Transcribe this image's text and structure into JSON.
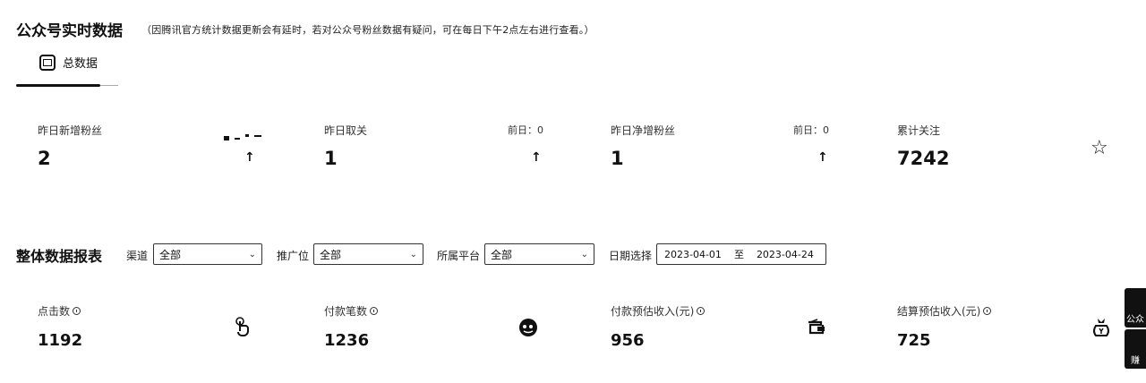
{
  "header": {
    "title": "公众号实时数据",
    "notice": "（因腾讯官方统计数据更新会有延时，若对公众号粉丝数据有疑问，可在每日下午2点左右进行查看。）"
  },
  "tabs": [
    {
      "label": "总数据",
      "icon": "chart-box-icon",
      "active": true
    }
  ],
  "stats": [
    {
      "label": "昨日新增粉丝",
      "value": "2",
      "compare": "",
      "trend_icon": "arrow-up-icon"
    },
    {
      "label": "昨日取关",
      "value": "1",
      "compare": "前日：0",
      "trend_icon": "arrow-up-icon"
    },
    {
      "label": "昨日净增粉丝",
      "value": "1",
      "compare": "前日：0",
      "trend_icon": "arrow-up-icon"
    },
    {
      "label": "累计关注",
      "value": "7242",
      "icon": "star-icon"
    }
  ],
  "report": {
    "title": "整体数据报表",
    "filters": {
      "channel": {
        "label": "渠道",
        "value": "全部"
      },
      "position": {
        "label": "推广位",
        "value": "全部"
      },
      "platform": {
        "label": "所属平台",
        "value": "全部"
      },
      "date": {
        "label": "日期选择",
        "start": "2023-04-01",
        "separator": "至",
        "end": "2023-04-24"
      }
    }
  },
  "metrics": [
    {
      "label": "点击数",
      "value": "1192",
      "icon": "tap-hand-icon"
    },
    {
      "label": "付款笔数",
      "value": "1236",
      "icon": "pay-face-icon"
    },
    {
      "label": "付款预估收入(元)",
      "value": "956",
      "icon": "wallet-icon"
    },
    {
      "label": "结算预估收入(元)",
      "value": "725",
      "icon": "money-bag-icon"
    }
  ],
  "side_tools": [
    {
      "label": "公众",
      "icon": "wechat-official-icon"
    },
    {
      "label": "赚",
      "icon": "earn-icon"
    }
  ]
}
